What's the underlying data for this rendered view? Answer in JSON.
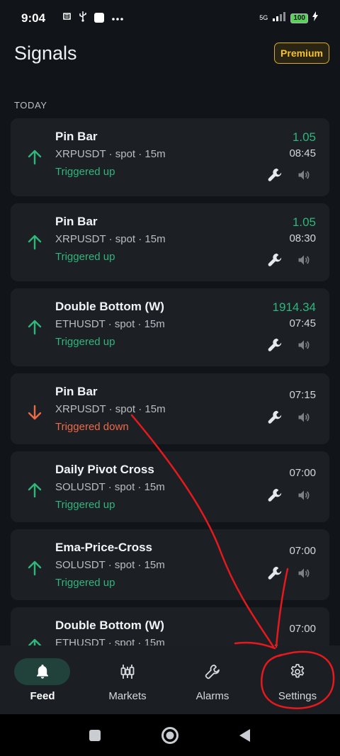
{
  "status_bar": {
    "time": "9:04",
    "network": "5G",
    "battery": "100"
  },
  "header": {
    "title": "Signals",
    "premium_label": "Premium"
  },
  "section_label": "TODAY",
  "signals": [
    {
      "title": "Pin Bar",
      "subtitle": "XRPUSDT · spot · 15m",
      "status": "Triggered up",
      "direction": "up",
      "price": "1.05",
      "time": "08:45"
    },
    {
      "title": "Pin Bar",
      "subtitle": "XRPUSDT · spot · 15m",
      "status": "Triggered up",
      "direction": "up",
      "price": "1.05",
      "time": "08:30"
    },
    {
      "title": "Double Bottom (W)",
      "subtitle": "ETHUSDT · spot · 15m",
      "status": "Triggered up",
      "direction": "up",
      "price": "1914.34",
      "time": "07:45"
    },
    {
      "title": "Pin Bar",
      "subtitle": "XRPUSDT · spot · 15m",
      "status": "Triggered down",
      "direction": "down",
      "price": "",
      "time": "07:15"
    },
    {
      "title": "Daily Pivot Cross",
      "subtitle": "SOLUSDT · spot · 15m",
      "status": "Triggered up",
      "direction": "up",
      "price": "",
      "time": "07:00"
    },
    {
      "title": "Ema-Price-Cross",
      "subtitle": "SOLUSDT · spot · 15m",
      "status": "Triggered up",
      "direction": "up",
      "price": "",
      "time": "07:00"
    },
    {
      "title": "Double Bottom (W)",
      "subtitle": "ETHUSDT · spot · 15m",
      "status": "",
      "direction": "up",
      "price": "",
      "time": "07:00"
    }
  ],
  "bottom_nav": [
    {
      "label": "Feed",
      "icon": "bell-icon",
      "active": true
    },
    {
      "label": "Markets",
      "icon": "candlestick-icon",
      "active": false
    },
    {
      "label": "Alarms",
      "icon": "wrench-icon",
      "active": false
    },
    {
      "label": "Settings",
      "icon": "gear-icon",
      "active": false
    }
  ],
  "colors": {
    "up": "#30b57a",
    "down": "#ee6a47",
    "premium": "#f5c22a",
    "annotation": "#e8191c"
  }
}
